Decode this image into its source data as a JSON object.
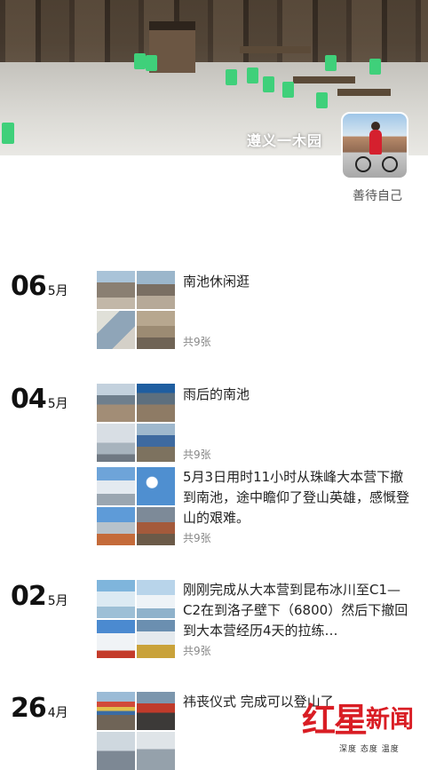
{
  "cover": {
    "caption": "遵义一木园"
  },
  "profile": {
    "name": "善待自己"
  },
  "entries": [
    {
      "day": "06",
      "month": "5月",
      "title": "南池休闲逛",
      "count": "共9张"
    },
    {
      "day": "04",
      "month": "5月",
      "title": "雨后的南池",
      "count": "共9张"
    },
    {
      "title": "5月3日用时11小时从珠峰大本营下撤到南池，途中瞻仰了登山英雄，感慨登山的艰难。",
      "count": "共9张"
    },
    {
      "day": "02",
      "month": "5月",
      "title": "刚刚完成从大本营到昆布冰川至C1—C2在到洛子壁下（6800）然后下撤回到大本营经历4天的拉练…",
      "count": "共9张"
    },
    {
      "day": "26",
      "month": "4月",
      "title": "祎丧仪式 完成可以登山了"
    }
  ],
  "watermark": {
    "brand1": "红星",
    "brand2": "新闻",
    "slogan": "深度 态度 温度"
  },
  "colors": {
    "accent": "#d91d24",
    "muted": "#888888"
  }
}
